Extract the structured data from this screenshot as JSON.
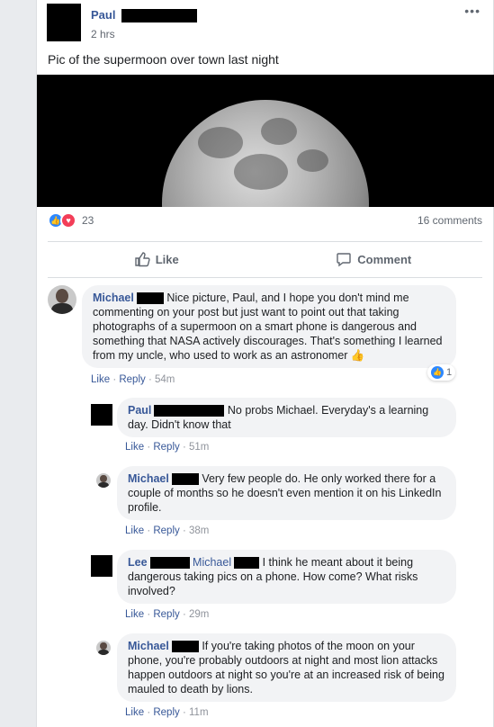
{
  "post": {
    "author": "Paul",
    "time": "2 hrs",
    "text": "Pic of the supermoon over town last night",
    "more": "•••",
    "reaction_count": "23",
    "comment_count": "16 comments",
    "like_label": "Like",
    "comment_label": "Comment"
  },
  "comments": [
    {
      "name": "Michael",
      "text": " Nice picture, Paul, and I hope you don't mind me commenting on your post but just want to point out that taking photographs of a supermoon on a smart phone is dangerous and something that NASA actively discourages. That's something I learned from my uncle, who used to work as an astronomer 👍",
      "like": "Like",
      "reply": "Reply",
      "time": "54m",
      "likes": "1"
    },
    {
      "name": "Paul",
      "text": " No probs Michael. Everyday's a learning day. Didn't know that",
      "like": "Like",
      "reply": "Reply",
      "time": "51m"
    },
    {
      "name": "Michael",
      "text": " Very few people do. He only worked there for a couple of months so he doesn't even mention it on his LinkedIn profile.",
      "like": "Like",
      "reply": "Reply",
      "time": "38m"
    },
    {
      "name": "Lee",
      "mention": "Michael",
      "text": " I think he meant about it being dangerous taking pics on a phone. How come? What risks involved?",
      "like": "Like",
      "reply": "Reply",
      "time": "29m"
    },
    {
      "name": "Michael",
      "text": " If you're taking photos of the moon on your phone, you're probably outdoors at night and most lion attacks happen outdoors at night so you're at an increased risk of being mauled to death by lions.",
      "like": "Like",
      "reply": "Reply",
      "time": "11m"
    }
  ],
  "sep": "·",
  "colors": {
    "link": "#385898",
    "like_blue": "#2d88ff",
    "love_red": "#f33e58"
  }
}
